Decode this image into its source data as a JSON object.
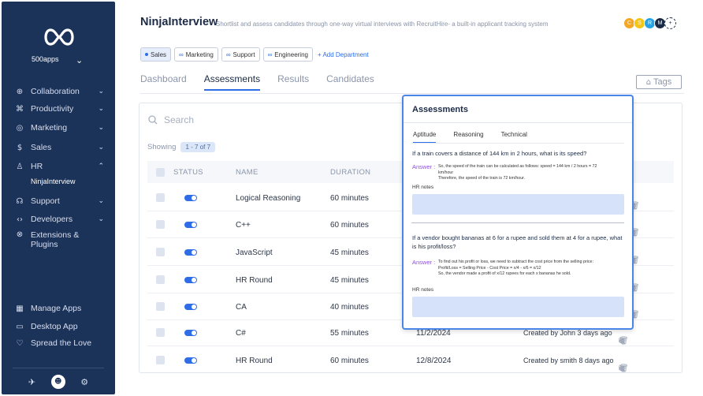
{
  "sidebar": {
    "org_name": "500apps",
    "items": [
      {
        "label": "Collaboration",
        "icon": "globe-icon",
        "glyph": "⊕",
        "chevron": true
      },
      {
        "label": "Productivity",
        "icon": "command-icon",
        "glyph": "⌘",
        "chevron": true
      },
      {
        "label": "Marketing",
        "icon": "target-icon",
        "glyph": "◎",
        "chevron": true
      },
      {
        "label": "Sales",
        "icon": "dollar-icon",
        "glyph": "$",
        "chevron": true
      },
      {
        "label": "HR",
        "icon": "user-icon",
        "glyph": "♙",
        "chevron": true
      },
      {
        "label": "Support",
        "icon": "headset-icon",
        "glyph": "☊",
        "chevron": true
      },
      {
        "label": "Developers",
        "icon": "code-icon",
        "glyph": "‹›",
        "chevron": true
      },
      {
        "label": "Extensions & Plugins",
        "icon": "plugin-icon",
        "glyph": "⊗",
        "chevron": false
      },
      {
        "label": "Manage Apps",
        "icon": "grid-icon",
        "glyph": "▦",
        "chevron": false
      },
      {
        "label": "Desktop App",
        "icon": "monitor-icon",
        "glyph": "▭",
        "chevron": false
      },
      {
        "label": "Spread the Love",
        "icon": "heart-icon",
        "glyph": "♡",
        "chevron": false
      }
    ],
    "hr_sub": "NinjaInterview"
  },
  "header": {
    "title": "NinjaInterview",
    "subtitle": "Shortlist and assess candidates through one-way virtual interviews with RecruitHire- a built-in applicant tracking system",
    "avatars": [
      {
        "letter": "C",
        "color": "#f5a623"
      },
      {
        "letter": "S",
        "color": "#f5c518"
      },
      {
        "letter": "R",
        "color": "#27a3e5"
      },
      {
        "letter": "M",
        "color": "#1c2b45"
      },
      {
        "letter": "+",
        "color": "#ffffff"
      }
    ]
  },
  "departments": {
    "chips": [
      "Sales",
      "Marketing",
      "Support",
      "Engineering"
    ],
    "add_label": "+ Add Department"
  },
  "tabs": [
    "Dashboard",
    "Assessments",
    "Results",
    "Candidates"
  ],
  "tags_label": "Tags",
  "table": {
    "search_placeholder": "Search",
    "showing_label": "Showing",
    "showing_range": "1 - 7 of 7",
    "headers": {
      "status": "STATUS",
      "name": "NAME",
      "duration": "DURATION"
    },
    "rows": [
      {
        "name": "Logical Reasoning",
        "duration": "60 minutes",
        "date": "",
        "created": ""
      },
      {
        "name": "C++",
        "duration": "60 minutes",
        "date": "",
        "created": ""
      },
      {
        "name": "JavaScript",
        "duration": "45 minutes",
        "date": "",
        "created": ""
      },
      {
        "name": "HR Round",
        "duration": "45 minutes",
        "date": "",
        "created": ""
      },
      {
        "name": "CA",
        "duration": "40 minutes",
        "date": "",
        "created": ""
      },
      {
        "name": "C#",
        "duration": "55 minutes",
        "date": "11/2/2024",
        "created": "Created by John 3 days ago"
      },
      {
        "name": "HR Round",
        "duration": "60 minutes",
        "date": "12/8/2024",
        "created": "Created by smith 8 days ago"
      }
    ]
  },
  "popup": {
    "title": "Assessments",
    "tabs": [
      "Aptitude",
      "Reasoning",
      "Technical"
    ],
    "questions": [
      {
        "question": "If a train covers a distance of 144 km in 2 hours, what is its speed?",
        "answer_label": "Answer :",
        "answer_lines": [
          "So, the speed of the train can be calculated as follows: speed = 144 km / 2 hours = 72",
          "km/hour",
          "Therefore, the speed of the train is 72 km/hour."
        ],
        "notes_label": "HR notes"
      },
      {
        "question": "If a vendor bought bananas at 6 for a rupee and sold them at 4 for a rupee, what is his profit/loss?",
        "answer_label": "Answer :",
        "answer_lines": [
          "To find out his profit or loss, we need to subtract the cost price from the selling price:",
          "Profit/Loss = Selling Price - Cost Price = x/4 - x/6 = x/12",
          "So, the vendor made a profit of x/12 rupees for each x bananas he sold."
        ],
        "notes_label": "HR notes"
      }
    ]
  },
  "colors": {
    "sidebar": "#1c3359",
    "accent": "#2e6de6",
    "answer": "#8c52d9",
    "notes": "#d6e2fa"
  }
}
